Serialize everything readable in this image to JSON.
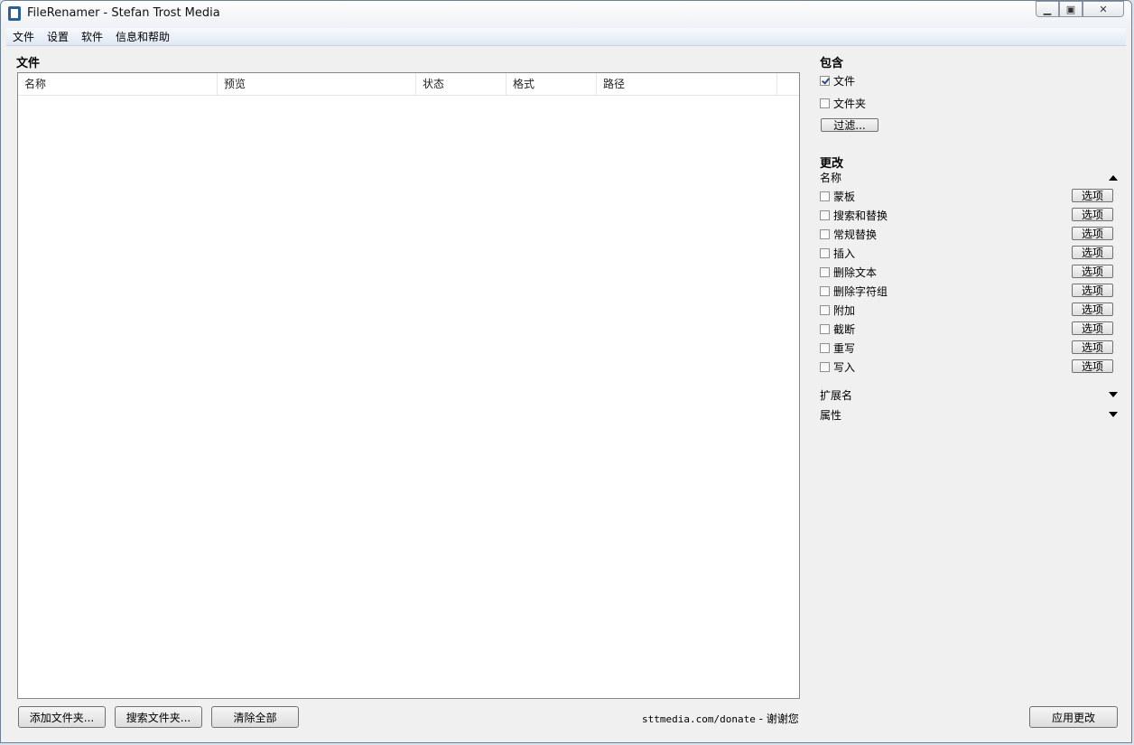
{
  "window": {
    "title": "FileRenamer - Stefan Trost Media"
  },
  "menu": [
    "文件",
    "设置",
    "软件",
    "信息和帮助"
  ],
  "files": {
    "title": "文件",
    "columns": [
      "名称",
      "预览",
      "状态",
      "格式",
      "路径"
    ],
    "rows": []
  },
  "bottom": {
    "add_folder": "添加文件夹...",
    "search_folder": "搜索文件夹...",
    "clear_all": "清除全部",
    "donate_link": "sttmedia.com/donate",
    "donate_thanks": " - 谢谢您",
    "apply": "应用更改"
  },
  "include": {
    "title": "包含",
    "files_label": "文件",
    "files_checked": true,
    "folders_label": "文件夹",
    "folders_checked": false,
    "filter_button": "过滤..."
  },
  "changes": {
    "title": "更改",
    "name_group": "名称",
    "option_label": "选项",
    "items": [
      "蒙板",
      "搜索和替换",
      "常规替换",
      "插入",
      "删除文本",
      "删除字符组",
      "附加",
      "截断",
      "重写",
      "写入"
    ],
    "extension_group": "扩展名",
    "attributes_group": "属性"
  }
}
